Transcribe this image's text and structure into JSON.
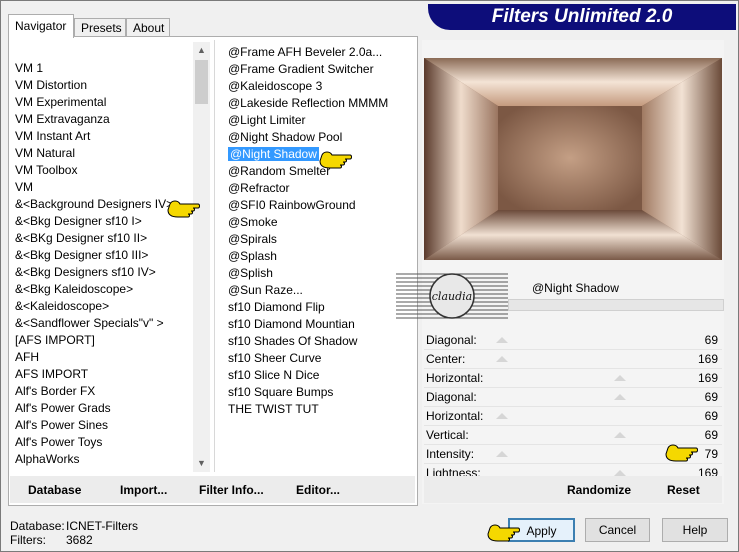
{
  "banner": "Filters Unlimited 2.0",
  "tabs": [
    "Navigator",
    "Presets",
    "About"
  ],
  "categories": [
    "VM 1",
    "VM Distortion",
    "VM Experimental",
    "VM Extravaganza",
    "VM Instant Art",
    "VM Natural",
    "VM Toolbox",
    "VM",
    "&<Background Designers IV>",
    "&<Bkg Designer sf10 I>",
    "&<BKg Designer sf10 II>",
    "&<Bkg Designer sf10 III>",
    "&<Bkg Designers sf10 IV>",
    "&<Bkg Kaleidoscope>",
    "&<Kaleidoscope>",
    "&<Sandflower Specials\"v\" >",
    "[AFS IMPORT]",
    "AFH",
    "AFS IMPORT",
    "Alf's Border FX",
    "Alf's Power Grads",
    "Alf's Power Sines",
    "Alf's Power Toys",
    "AlphaWorks"
  ],
  "filters": [
    "@Frame AFH Beveler 2.0a...",
    "@Frame Gradient Switcher",
    "@Kaleidoscope 3",
    "@Lakeside Reflection MMMM",
    "@Light Limiter",
    "@Night Shadow Pool",
    "@Night Shadow",
    "@Random Smelter",
    "@Refractor",
    "@SFI0 RainbowGround",
    "@Smoke",
    "@Spirals",
    "@Splash",
    "@Splish",
    "@Sun Raze...",
    "sf10 Diamond Flip",
    "sf10 Diamond Mountian",
    "sf10 Shades Of Shadow",
    "sf10 Sheer Curve",
    "sf10 Slice N Dice",
    "sf10 Square Bumps",
    "THE TWIST TUT"
  ],
  "selected_filter_index": 6,
  "bottom_buttons": {
    "database": "Database",
    "import": "Import...",
    "filter_info": "Filter Info...",
    "editor": "Editor..."
  },
  "filter_name": "@Night Shadow",
  "params": [
    {
      "label": "Diagonal:",
      "value": "69"
    },
    {
      "label": "Center:",
      "value": "169"
    },
    {
      "label": "Horizontal:",
      "value": "169"
    },
    {
      "label": "Diagonal:",
      "value": "69"
    },
    {
      "label": "Horizontal:",
      "value": "69"
    },
    {
      "label": "Vertical:",
      "value": "69"
    },
    {
      "label": "Intensity:",
      "value": "79"
    },
    {
      "label": "Lightness:",
      "value": "169"
    }
  ],
  "right_buttons": {
    "randomize": "Randomize",
    "reset": "Reset"
  },
  "status": {
    "database_label": "Database:",
    "database_value": "ICNET-Filters",
    "filters_label": "Filters:",
    "filters_value": "3682"
  },
  "dialog_buttons": {
    "apply": "Apply",
    "cancel": "Cancel",
    "help": "Help"
  },
  "watermark": "claudia",
  "colors": {
    "banner": "#0d0d7a",
    "selection": "#3399ff",
    "hand": "#f5d800"
  }
}
